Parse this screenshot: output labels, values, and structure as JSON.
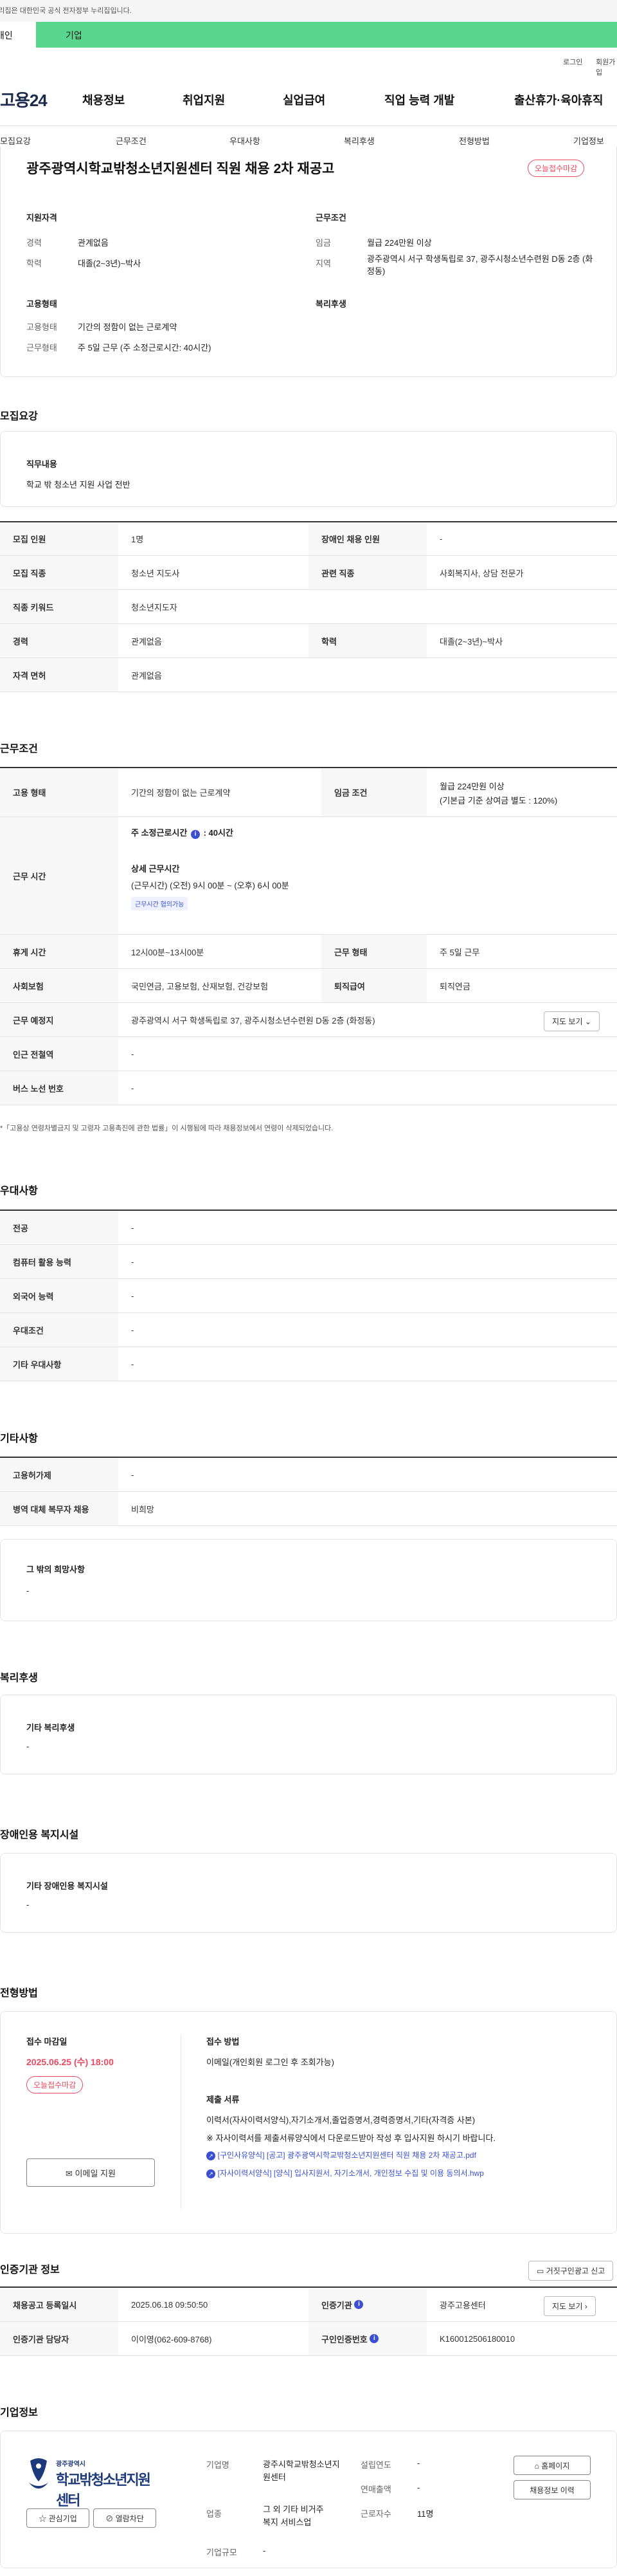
{
  "gov": {
    "notice": "이 누리집은 대한민국 공식 전자정부 누리집입니다."
  },
  "tabs": {
    "personal": "개인",
    "company": "기업"
  },
  "util": {
    "login": "로그인",
    "join": "회원가입"
  },
  "logo": "고용24",
  "gnb": [
    "채용정보",
    "취업지원",
    "실업급여",
    "직업 능력 개발",
    "출산휴가·육아휴직"
  ],
  "anchors": [
    "모집요강",
    "근무조건",
    "우대사항",
    "복리후생",
    "전형방법",
    "기업정보"
  ],
  "job": {
    "title": "광주광역시학교밖청소년지원센터 직원 채용 2차 재공고",
    "badge": "오늘접수마감",
    "summary": {
      "qual_head": "지원자격",
      "career_l": "경력",
      "career_v": "관계없음",
      "edu_l": "학력",
      "edu_v": "대졸(2~3년)~박사",
      "type_head": "고용형태",
      "etype_l": "고용형태",
      "etype_v": "기간의 정함이 없는 근로계약",
      "wform_l": "근무형태",
      "wform_v": "주 5일 근무 (주 소정근로시간: 40시간)",
      "cond_head": "근무조건",
      "wage_l": "임금",
      "wage_v": "월급 224만원 이상",
      "region_l": "지역",
      "region_v": "광주광역시 서구 학생독립로 37, 광주시청소년수련원 D동 2층 (화정동)",
      "welfare_head": "복리후생"
    }
  },
  "recruit": {
    "title": "모집요강",
    "duty_label": "직무내용",
    "duty_value": "학교 밖 청소년 지원 사업 전반",
    "rows": [
      {
        "l1": "모집 인원",
        "v1": "1명",
        "l2": "장애인 채용 인원",
        "v2": "-"
      },
      {
        "l1": "모집 직종",
        "v1": "청소년 지도사",
        "l2": "관련 직종",
        "v2": "사회복지사, 상담 전문가"
      },
      {
        "l1": "직종 키워드",
        "v1": "청소년지도자"
      },
      {
        "l1": "경력",
        "v1": "관계없음",
        "l2": "학력",
        "v2": "대졸(2~3년)~박사"
      },
      {
        "l1": "자격 면허",
        "v1": "관계없음"
      }
    ]
  },
  "work": {
    "title": "근무조건",
    "etype_l": "고용 형태",
    "etype_v": "기간의 정함이 없는 근로계약",
    "wage_l": "임금 조건",
    "wage_v": "월급 224만원 이상",
    "wage_note": "(기본급 기준 상여금 별도 : 120%)",
    "hours_l": "근무 시간",
    "hours_std_label": "주 소정근로시간",
    "hours_std_value": ": 40시간",
    "hours_detail_label": "상세 근무시간",
    "hours_detail_value": "(근무시간) (오전) 9시 00분 ~ (오후) 6시 00분",
    "hours_tag": "근무시간 협의가능",
    "break_l": "휴게 시간",
    "break_v": "12시00분~13시00분",
    "wform_l": "근무 형태",
    "wform_v": "주 5일 근무",
    "ins_l": "사회보험",
    "ins_v": "국민연금, 고용보험, 산재보험, 건강보험",
    "ret_l": "퇴직급여",
    "ret_v": "퇴직연금",
    "loc_l": "근무 예정지",
    "loc_v": "광주광역시 서구 학생독립로 37, 광주시청소년수련원 D동 2층 (화정동)",
    "map_btn": "지도 보기",
    "subway_l": "인근 전철역",
    "subway_v": "-",
    "bus_l": "버스 노선 번호",
    "bus_v": "-",
    "footnote": "*「고용상 연령차별금지 및 고령자 고용촉진에 관한 법률」이 시행됨에 따라 채용정보에서 연령이 삭제되었습니다."
  },
  "pref": {
    "title": "우대사항",
    "rows": [
      {
        "l": "전공",
        "v": "-"
      },
      {
        "l": "컴퓨터 활용 능력",
        "v": "-"
      },
      {
        "l": "외국어 능력",
        "v": "-"
      },
      {
        "l": "우대조건",
        "v": "-"
      },
      {
        "l": "기타 우대사항",
        "v": "-"
      }
    ]
  },
  "etc": {
    "title": "기타사항",
    "rows": [
      {
        "l": "고용허가제",
        "v": "-"
      },
      {
        "l": "병역 대체 복무자 채용",
        "v": "비희망"
      }
    ],
    "other_label": "그 밖의 희망사항",
    "other_value": "-"
  },
  "welfare": {
    "title": "복리후생",
    "label": "기타 복리후생",
    "value": "-"
  },
  "disabled": {
    "title": "장애인용 복지시설",
    "label": "기타 장애인용 복지시설",
    "value": "-"
  },
  "apply": {
    "title": "전형방법",
    "deadline_l": "접수 마감일",
    "deadline_v": "2025.06.25 (수) 18:00",
    "badge": "오늘접수마감",
    "email_btn": "이메일 지원",
    "method_l": "접수 방법",
    "method_v": "이메일(개인회원 로그인 후 조회가능)",
    "docs_l": "제출 서류",
    "docs_v": "이력서(자사이력서양식),자기소개서,졸업증명서,경력증명서,기타(자격증 사본)",
    "docs_note": "※ 자사이력서를 제출서류양식에서 다운로드받아 작성 후 입사지원 하시기 바랍니다.",
    "files": [
      "[구인사유양식] [공고] 광주광역시학교밖청소년지원센터 직원 채용 2차 재공고.pdf",
      "[자사이력서양식] [양식] 입사지원서, 자기소개서, 개인정보 수집 및 이용 동의서.hwp"
    ]
  },
  "cert": {
    "title": "인증기관 정보",
    "report_btn": "거짓구인광고 신고",
    "reg_l": "채용공고 등록일시",
    "reg_v": "2025.06.18 09:50:50",
    "org_l": "인증기관",
    "org_v": "광주고용센터",
    "map_btn": "지도 보기",
    "mgr_l": "인증기관 담당자",
    "mgr_v": "이이영(062-609-8768)",
    "num_l": "구인인증번호",
    "num_v": "K160012506180010"
  },
  "company": {
    "title": "기업정보",
    "logo_small": "광주광역시",
    "logo_big": "학교밖청소년지원센터",
    "fav_btn": "관심기업",
    "block_btn": "열람차단",
    "name_l": "기업명",
    "name_v": "광주시학교밖청소년지원센터",
    "biz_l": "업종",
    "biz_v": "그 외 기타 비거주 복지 서비스업",
    "size_l": "기업규모",
    "size_v": "-",
    "year_l": "설립연도",
    "year_v": "-",
    "sales_l": "연매출액",
    "sales_v": "-",
    "emp_l": "근로자수",
    "emp_v": "11명",
    "home_btn": "홈페이지",
    "list_btn": "채용정보 이력"
  }
}
